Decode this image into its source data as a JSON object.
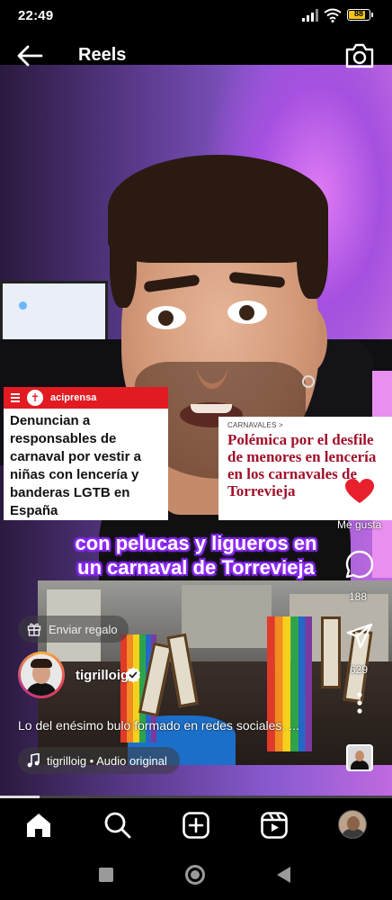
{
  "status_bar": {
    "time": "22:49",
    "battery": "88",
    "battery_level": 0.88
  },
  "header": {
    "title": "Reels"
  },
  "news_left": {
    "brand": "aciprensa",
    "headline": "Denuncian a responsables de carnaval por vestir a niñas con lencería y banderas LGTB en España"
  },
  "news_right": {
    "kicker": "CARNAVALES >",
    "headline": "Polémica por el desfile de menores en lencería en los carnavales de Torrevieja"
  },
  "actions": {
    "like_label": "Me gusta",
    "comment_count": "188",
    "share_count": "629"
  },
  "overlay": {
    "line1": "con pelucas y ligueros en",
    "line2": "un carnaval de Torrevieja"
  },
  "gift": {
    "label": "Enviar regalo"
  },
  "author": {
    "username": "tigrilloig"
  },
  "description": "Lo del enésimo bulo formado en redes sociales. ...",
  "audio": {
    "label": "tigrilloig • Audio original"
  },
  "progress": {
    "fraction": 0.1
  },
  "colors": {
    "accent_purple": "#8b2bff",
    "news_red": "#e21b23",
    "heart_red": "#e8202c"
  },
  "icons": {
    "back": "arrow-left-icon",
    "camera": "camera-icon",
    "heart": "heart-icon",
    "comment": "comment-icon",
    "share": "send-icon",
    "more": "more-icon",
    "gift": "gift-icon",
    "verified": "verified-badge-icon",
    "music": "music-note-icon",
    "home": "home-icon",
    "search": "search-icon",
    "create": "create-post-icon",
    "reels": "reels-icon"
  }
}
